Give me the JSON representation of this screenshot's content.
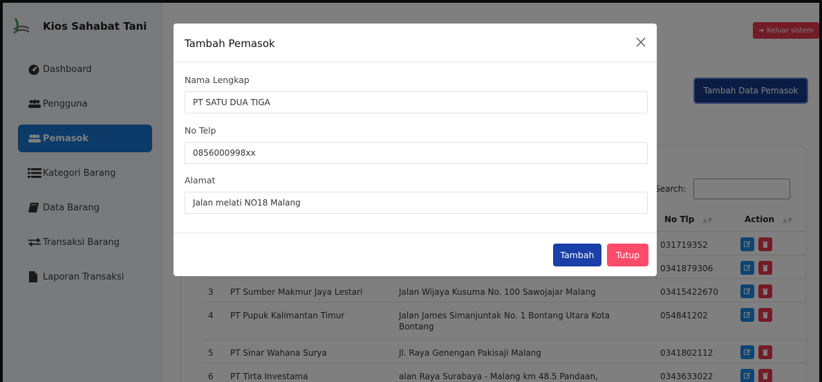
{
  "sidebar": {
    "brand": "Kios Sahabat Tani",
    "items": [
      {
        "label": "Dashboard",
        "icon": "dashboard-icon",
        "active": false
      },
      {
        "label": "Pengguna",
        "icon": "users-icon",
        "active": false
      },
      {
        "label": "Pemasok",
        "icon": "users-icon",
        "active": true
      },
      {
        "label": "Kategori Barang",
        "icon": "list-icon",
        "active": false
      },
      {
        "label": "Data Barang",
        "icon": "book-icon",
        "active": false
      },
      {
        "label": "Transaksi Barang",
        "icon": "exchange-icon",
        "active": false
      },
      {
        "label": "Laporan Transaksi",
        "icon": "file-icon",
        "active": false
      }
    ]
  },
  "header": {
    "logout_label": "Keluar sistem",
    "add_label": "Tambah Data Pemasok"
  },
  "table": {
    "search_label": "Search:",
    "columns": [
      "No Tlp",
      "Action"
    ],
    "rows": [
      {
        "no": "",
        "name": "",
        "address": "",
        "phone": "031719352"
      },
      {
        "no": "",
        "name": "",
        "address": "",
        "phone": "0341879306"
      },
      {
        "no": "3",
        "name": "PT Sumber Makmur Jaya Lestari",
        "address": "Jalan Wijaya Kusuma No. 100 Sawojajar Malang",
        "phone": "03415422670"
      },
      {
        "no": "4",
        "name": "PT Pupuk Kalimantan Timur",
        "address": "Jalan James Simanjuntak No. 1 Bontang Utara Kota Bontang",
        "phone": "054841202"
      },
      {
        "no": "5",
        "name": "PT Sinar Wahana Surya",
        "address": "Jl. Raya Genengan Pakisaji Malang",
        "phone": "0341802112"
      },
      {
        "no": "6",
        "name": "PT Tirta Investama",
        "address": "alan Raya Surabaya - Malang km 48.5 Pandaan, Pasuruan,",
        "phone": "0343633022"
      }
    ]
  },
  "modal": {
    "title": "Tambah Pemasok",
    "fields": [
      {
        "label": "Nama Lengkap",
        "value": "PT SATU DUA TIGA"
      },
      {
        "label": "No Telp",
        "value": "0856000998xx"
      },
      {
        "label": "Alamat",
        "value": "Jalan melati NO18 Malang"
      }
    ],
    "submit_label": "Tambah",
    "close_label": "Tutup"
  },
  "colors": {
    "active_nav": "#1976d2",
    "primary": "#163a8a",
    "danger": "#e53950",
    "close_button": "#ff4b6a"
  }
}
